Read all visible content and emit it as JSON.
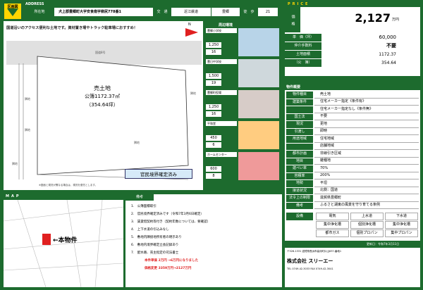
{
  "header": {
    "section_label": "区画図",
    "address_label": "ADDRESS",
    "location_label": "所在地",
    "location_value": "犬上郡豊郷町大字安食南字柳尻778番1",
    "transport_label": "交　通",
    "railway": "近江鉄道",
    "station": "豊郷",
    "walk_label": "徒　歩",
    "walk_minutes": "21",
    "price_label": "PRICE"
  },
  "plot": {
    "headline": "国道沿いのアクセス便利な土地です。資材置き場やトラック駐車場におすすめ！",
    "title": "売土地",
    "area_m2": "公簿1172.37㎡",
    "area_tsubo": "（354.64坪）",
    "boundary": "官民境界確定済み",
    "road_label": "国道8号",
    "north": "N",
    "note": "※図面と現況が異なる場合は、現況を優先とします。",
    "neighbors": [
      "隣地",
      "隣地",
      "隣地",
      "隣地",
      "隣地"
    ]
  },
  "nearby": {
    "title": "周辺環境",
    "items": [
      {
        "name": "豊郷小学校",
        "dist": "1,250",
        "min": "16"
      },
      {
        "name": "豊日中学校",
        "dist": "1,500",
        "min": "19"
      },
      {
        "name": "豊郷町役場",
        "dist": "1,250",
        "min": "16"
      },
      {
        "name": "平和堂",
        "dist": "450",
        "min": "6"
      },
      {
        "name": "ホームセンター",
        "dist": "600",
        "min": "8"
      }
    ]
  },
  "price": {
    "price_label": "価　格",
    "price_value": "2,127",
    "price_unit": "万円",
    "unit_price_label": "単　価（坪）",
    "unit_price_value": "60,000",
    "fee_label": "仲介手数料",
    "fee_value": "不要",
    "land_area_label": "土地面積",
    "land_area_value": "1172.37",
    "kobo_label": "（公　簿）",
    "kobo_value": "354.64"
  },
  "summary": {
    "title": "物件概要",
    "rows": [
      {
        "label": "物件種目",
        "value": "売土地"
      },
      {
        "label": "建築条件",
        "value": "住宅メーカー指定《条件有》"
      },
      {
        "label": "",
        "value": "住宅メーカー指定なし《条件無》"
      },
      {
        "label": "国土法",
        "value": "不要"
      },
      {
        "label": "現況",
        "value": "更地"
      },
      {
        "label": "引渡し",
        "value": "即時"
      },
      {
        "label": "用途地域",
        "value": "住宅地域"
      },
      {
        "label": "",
        "value": "店舗地域"
      },
      {
        "label": "都市計画",
        "value": "非線引き区域"
      },
      {
        "label": "地目",
        "value": "雑種地"
      },
      {
        "label": "建ぺい率",
        "value": "70%"
      },
      {
        "label": "容積率",
        "value": "200%"
      },
      {
        "label": "地勢",
        "value": "平坦"
      },
      {
        "label": "接道状況",
        "value": "北側：国道"
      },
      {
        "label": "法令上の制限",
        "value": "滋賀県豊郷町"
      },
      {
        "label": "備考",
        "value": "ふるさと湖東の風景を守り育てる条例"
      }
    ],
    "infra": [
      {
        "label": "設備",
        "items": [
          "電気",
          "上水道",
          "下水道"
        ]
      },
      {
        "label": "",
        "items": [
          "集中浄化槽",
          "個別浄化槽",
          "集中浄化槽"
        ]
      },
      {
        "label": "",
        "items": [
          "都市ガス",
          "個別プロパン",
          "集中プロパン"
        ]
      }
    ],
    "updated": "更新日：令和7年3月11日"
  },
  "notes": {
    "title": "備考",
    "items": [
      "1.　公簿面積取引",
      "2.　官民境界確定済みです（令和7年3月6日確定）",
      "3.　賃貸借契約等付き（契約年数については、要確認）",
      "4.　上下水道の引込みなし",
      "5.　敷地内隣接地所有者の明示あり",
      "6.　敷地内境界確定立会記録あり",
      "7.　配水路、売主指定の司法書士",
      "本件単価 2万円 →6万円になりました",
      "価格変更 3359万円→2127万円"
    ]
  },
  "map": {
    "label": "MAP",
    "marker": "←本物件"
  },
  "company": {
    "name": "株式会社 スリーエー",
    "lines": [
      "〒526-1331 滋賀県長浜市高月町片山837-番地1",
      "TEL 0749-42-3033 FAX 0749-42-3041"
    ]
  }
}
